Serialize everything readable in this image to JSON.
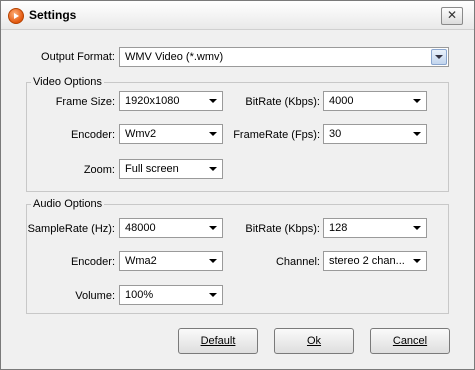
{
  "window": {
    "title": "Settings"
  },
  "output_format": {
    "label": "Output Format:",
    "value": "WMV Video (*.wmv)"
  },
  "video_options": {
    "title": "Video Options",
    "frame_size": {
      "label": "Frame Size:",
      "value": "1920x1080"
    },
    "video_bitrate": {
      "label": "BitRate (Kbps):",
      "value": "4000"
    },
    "encoder": {
      "label": "Encoder:",
      "value": "Wmv2"
    },
    "frame_rate": {
      "label": "FrameRate (Fps):",
      "value": "30"
    },
    "zoom": {
      "label": "Zoom:",
      "value": "Full screen"
    }
  },
  "audio_options": {
    "title": "Audio Options",
    "sample_rate": {
      "label": "SampleRate (Hz):",
      "value": "48000"
    },
    "audio_bitrate": {
      "label": "BitRate (Kbps):",
      "value": "128"
    },
    "encoder": {
      "label": "Encoder:",
      "value": "Wma2"
    },
    "channel": {
      "label": "Channel:",
      "value": "stereo 2 chan..."
    },
    "volume": {
      "label": "Volume:",
      "value": "100%"
    }
  },
  "buttons": {
    "default": "Default",
    "ok": "Ok",
    "cancel": "Cancel"
  },
  "colors": {
    "window_bg": "#f0f0f0",
    "icon_accent": "#e2570d"
  },
  "icons": {
    "app": "app-play-icon",
    "close": "close-icon",
    "dropdown": "chevron-down-icon"
  }
}
